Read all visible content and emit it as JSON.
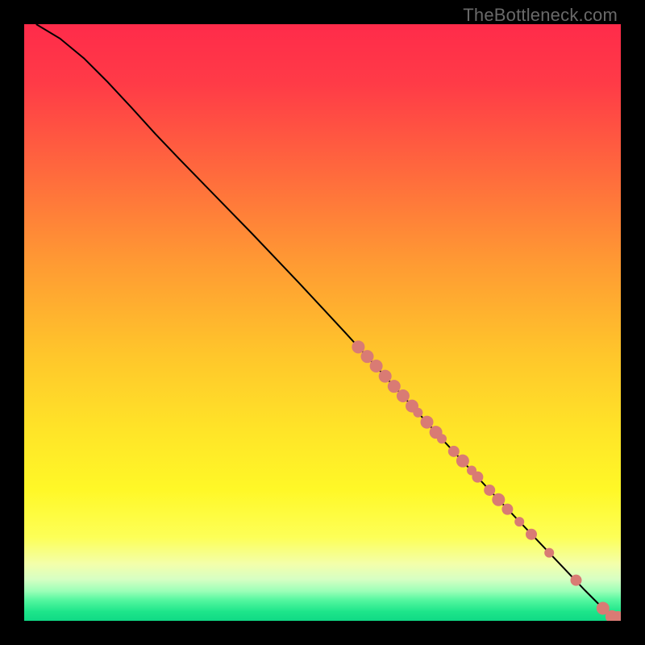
{
  "watermark": "TheBottleneck.com",
  "colors": {
    "curve": "#000000",
    "points": "#d97b74",
    "gradient_stops": [
      {
        "offset": 0.0,
        "color": "#ff2b4a"
      },
      {
        "offset": 0.1,
        "color": "#ff3b47"
      },
      {
        "offset": 0.25,
        "color": "#ff6a3d"
      },
      {
        "offset": 0.4,
        "color": "#ff9a33"
      },
      {
        "offset": 0.55,
        "color": "#ffc52b"
      },
      {
        "offset": 0.68,
        "color": "#ffe428"
      },
      {
        "offset": 0.78,
        "color": "#fff827"
      },
      {
        "offset": 0.86,
        "color": "#fdff57"
      },
      {
        "offset": 0.905,
        "color": "#f3ffab"
      },
      {
        "offset": 0.93,
        "color": "#d7ffc3"
      },
      {
        "offset": 0.95,
        "color": "#9cffb8"
      },
      {
        "offset": 0.965,
        "color": "#55f7a0"
      },
      {
        "offset": 0.985,
        "color": "#1de58a"
      },
      {
        "offset": 1.0,
        "color": "#10d985"
      }
    ]
  },
  "chart_data": {
    "type": "line",
    "title": "",
    "xlabel": "",
    "ylabel": "",
    "xlim": [
      0,
      100
    ],
    "ylim": [
      0,
      100
    ],
    "series": [
      {
        "name": "curve",
        "x": [
          2,
          6,
          10,
          14,
          18,
          22,
          26,
          30,
          34,
          38,
          42,
          46,
          50,
          54,
          58,
          62,
          66,
          70,
          74,
          78,
          82,
          86,
          90,
          94,
          97,
          99,
          100
        ],
        "y": [
          100.0,
          97.6,
          94.3,
          90.3,
          86.0,
          81.6,
          77.4,
          73.3,
          69.2,
          65.1,
          60.9,
          56.7,
          52.4,
          48.1,
          43.7,
          39.3,
          34.9,
          30.5,
          26.2,
          21.9,
          17.7,
          13.5,
          9.3,
          5.1,
          2.1,
          0.7,
          0.0
        ]
      },
      {
        "name": "points",
        "x": [
          56.0,
          57.5,
          59.0,
          60.5,
          62.0,
          63.5,
          65.0,
          66.0,
          67.5,
          69.0,
          70.0,
          72.0,
          73.5,
          75.0,
          76.0,
          78.0,
          79.5,
          81.0,
          83.0,
          85.0,
          88.0,
          92.5,
          97.0,
          98.5,
          99.5
        ],
        "y": [
          45.9,
          44.3,
          42.7,
          41.0,
          39.3,
          37.7,
          36.0,
          34.9,
          33.3,
          31.6,
          30.5,
          28.4,
          26.8,
          25.2,
          24.1,
          21.9,
          20.3,
          18.7,
          16.6,
          14.5,
          11.4,
          6.8,
          2.1,
          0.7,
          0.0
        ]
      }
    ],
    "point_sizes": [
      8,
      8,
      8,
      8,
      8,
      8,
      8,
      6,
      8,
      8,
      6,
      7,
      8,
      6,
      7,
      7,
      8,
      7,
      6,
      7,
      6,
      7,
      8,
      8,
      12
    ]
  }
}
